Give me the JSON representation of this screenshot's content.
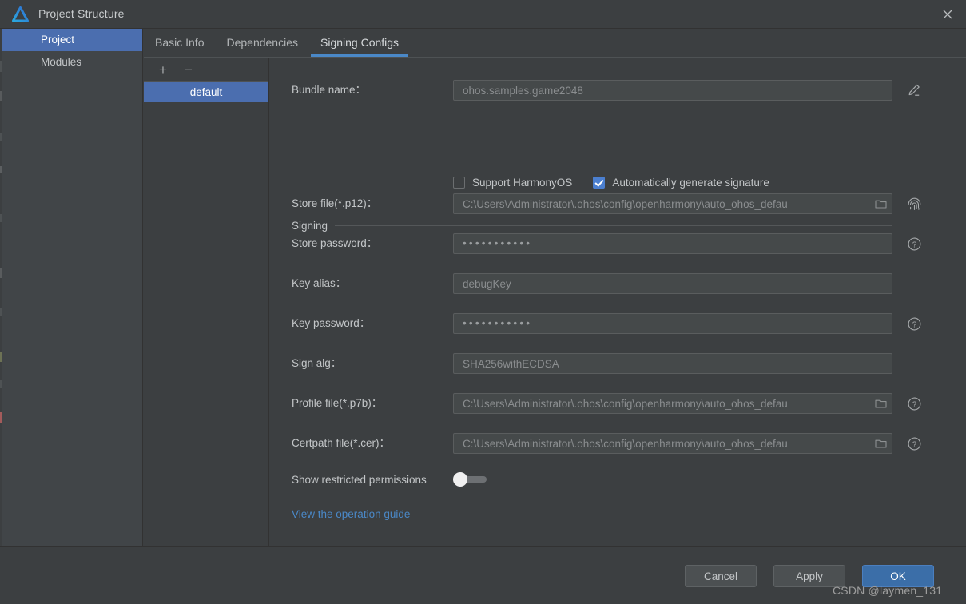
{
  "window": {
    "title": "Project Structure",
    "logo_icon": "deveco-logo-icon",
    "close_icon": "close-icon"
  },
  "sidebar": {
    "items": [
      {
        "label": "Project",
        "active": true
      },
      {
        "label": "Modules",
        "active": false
      }
    ]
  },
  "tabs": [
    {
      "label": "Basic Info",
      "active": false
    },
    {
      "label": "Dependencies",
      "active": false
    },
    {
      "label": "Signing Configs",
      "active": true
    }
  ],
  "configs": {
    "add_label": "+",
    "remove_label": "−",
    "items": [
      {
        "label": "default",
        "active": true
      }
    ]
  },
  "form": {
    "bundle_name": {
      "label": "Bundle name：",
      "value": "ohos.samples.game2048",
      "edit_icon": "pencil-icon"
    },
    "checkboxes": [
      {
        "label": "Support HarmonyOS",
        "checked": false
      },
      {
        "label": "Automatically generate signature",
        "checked": true
      }
    ],
    "section_title": "Signing",
    "fields": [
      {
        "label": "Store file(*.p12)：",
        "value": "C:\\Users\\Administrator\\.ohos\\config\\openharmony\\auto_ohos_defau",
        "type": "text",
        "browse_icon": "folder-icon",
        "side_icon": "fingerprint-icon"
      },
      {
        "label": "Store password：",
        "value": "•••••••••••",
        "type": "password",
        "browse_icon": "",
        "side_icon": "help-icon"
      },
      {
        "label": "Key alias：",
        "value": "debugKey",
        "type": "text",
        "browse_icon": "",
        "side_icon": ""
      },
      {
        "label": "Key password：",
        "value": "•••••••••••",
        "type": "password",
        "browse_icon": "",
        "side_icon": "help-icon"
      },
      {
        "label": "Sign alg：",
        "value": "SHA256withECDSA",
        "type": "text",
        "browse_icon": "",
        "side_icon": ""
      },
      {
        "label": "Profile file(*.p7b)：",
        "value": "C:\\Users\\Administrator\\.ohos\\config\\openharmony\\auto_ohos_defau",
        "type": "text",
        "browse_icon": "folder-icon",
        "side_icon": "help-icon"
      },
      {
        "label": "Certpath file(*.cer)：",
        "value": "C:\\Users\\Administrator\\.ohos\\config\\openharmony\\auto_ohos_defau",
        "type": "text",
        "browse_icon": "folder-icon",
        "side_icon": "help-icon"
      }
    ],
    "toggle": {
      "label": "Show restricted permissions",
      "on": false
    },
    "guide_link": "View the operation guide"
  },
  "footer": {
    "cancel": "Cancel",
    "apply": "Apply",
    "ok": "OK"
  },
  "watermark": "CSDN @laymen_131",
  "colors": {
    "accent": "#4b6eaf",
    "tab_underline": "#4a88c7",
    "link": "#4a88c7",
    "checkbox_checked": "#4b7fd0",
    "primary_button": "#3b6ea8",
    "window_bg": "#3c3f41",
    "sidebar_bg": "#414548",
    "field_bg": "#45494a"
  }
}
